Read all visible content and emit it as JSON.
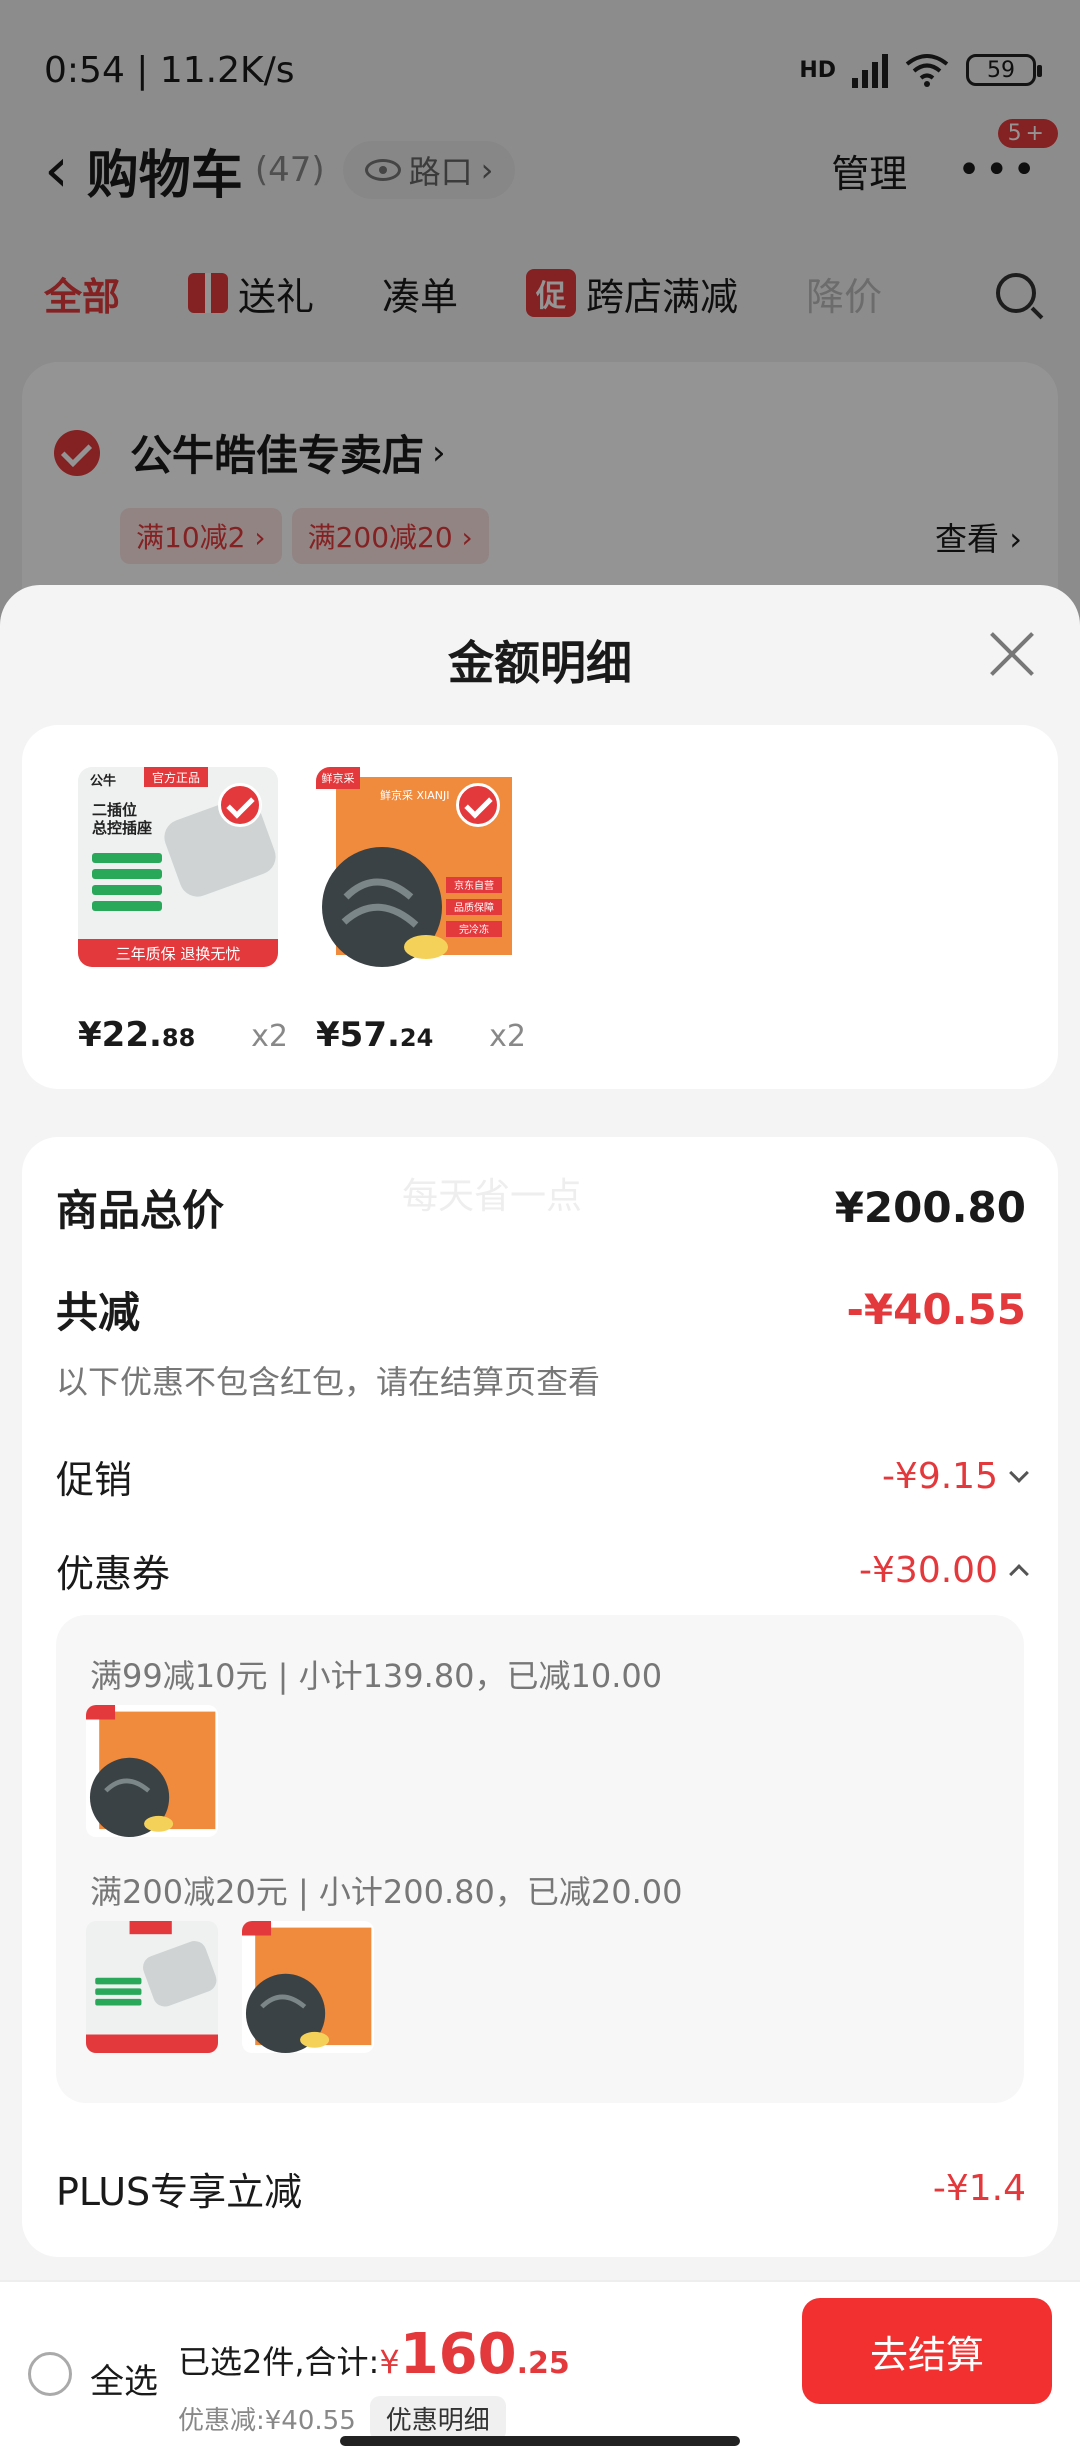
{
  "status_bar": {
    "time": "0:54 | 11.2K/s",
    "network": "HD",
    "wifi": "6",
    "battery": "59"
  },
  "header": {
    "title": "购物车",
    "count": "(47)",
    "location": "路口",
    "manage": "管理",
    "badge": "5+"
  },
  "tabs": [
    {
      "label": "全部"
    },
    {
      "label": "送礼"
    },
    {
      "label": "凑单"
    },
    {
      "label": "跨店满减",
      "tag": "促"
    },
    {
      "label": "降价"
    }
  ],
  "store": {
    "name": "公牛皓佳专卖店",
    "promos": [
      "满10减2",
      "满200减20"
    ],
    "view": "查看"
  },
  "sheet": {
    "title": "金额明细",
    "items": [
      {
        "name": "公牛 二插位总控插座",
        "tag": "官方正品",
        "line1": "二插位",
        "line2": "总控插座",
        "banner": "三年质保 退换无忧",
        "brand": "公牛",
        "price_main": "¥22.",
        "price_sub": "88",
        "qty": "x2"
      },
      {
        "name": "鲜京采 虾",
        "tag": "鲜京采",
        "brand_text": "鲜京采 XIANJI",
        "side1": "京东自营",
        "side2": "品质保障",
        "side3": "完冷冻",
        "price_main": "¥57.",
        "price_sub": "24",
        "qty": "x2"
      }
    ],
    "summary": {
      "watermark": "每天省一点",
      "total_label": "商品总价",
      "total_value": "¥200.80",
      "reduce_label": "共减",
      "reduce_value": "-¥40.55",
      "note": "以下优惠不包含红包，请在结算页查看",
      "promo_label": "促销",
      "promo_value": "-¥9.15",
      "coupon_label": "优惠券",
      "coupon_value": "-¥30.00",
      "coupons": [
        {
          "text": "满99减10元 | 小计139.80，已减10.00"
        },
        {
          "text": "满200减20元 | 小计200.80，已减20.00"
        }
      ],
      "plus_label": "PLUS专享立减",
      "plus_value": "-¥1.4"
    }
  },
  "bottom_bar": {
    "select_all": "全选",
    "selected_prefix": "已选2件,合计:",
    "total_yen": "¥",
    "total_int": "160",
    "total_dec": ".25",
    "discount": "优惠减:¥40.55",
    "detail_btn": "优惠明细",
    "checkout": "去结算"
  },
  "colors": {
    "accent": "#e4393c",
    "checkout": "#f23030"
  }
}
